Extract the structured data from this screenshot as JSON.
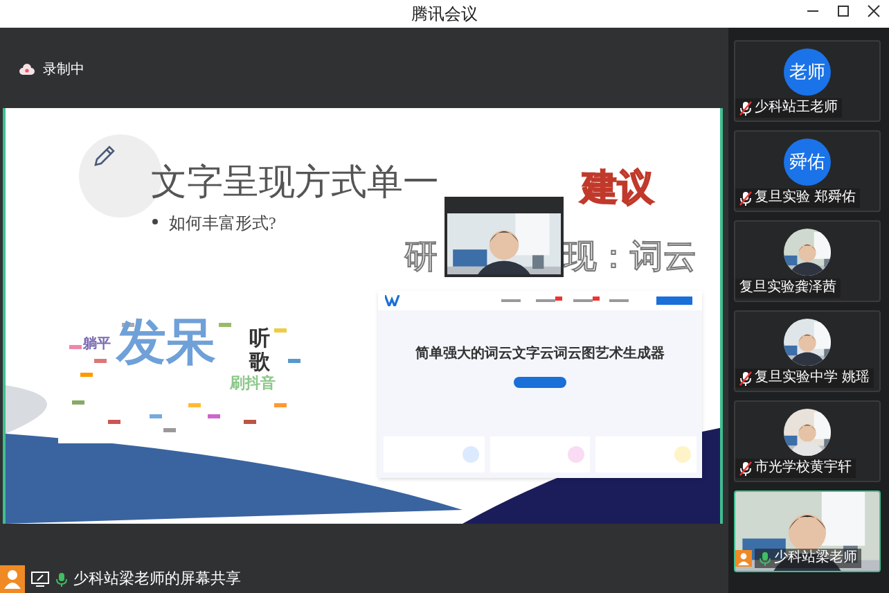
{
  "window": {
    "title": "腾讯会议"
  },
  "recording": {
    "label": "录制中"
  },
  "shared_slide": {
    "title": "文字呈现方式单一",
    "bullet": "如何丰富形式?",
    "suggestion": "建议",
    "subtitle_left": "研",
    "subtitle_right": "现：词云",
    "word_cloud": [
      {
        "text": "躺平",
        "kind": "small",
        "color": "#7a6bb0"
      },
      {
        "text": "发呆",
        "kind": "big",
        "color": "#6fa0d8"
      },
      {
        "text": "听歌",
        "kind": "vertical",
        "color": "#333333"
      },
      {
        "text": "刷抖音",
        "kind": "medium",
        "color": "#8cc88a"
      }
    ],
    "website": {
      "headline": "简单强大的词云文字云词云图艺术生成器"
    }
  },
  "participants": [
    {
      "name": "少科站王老师",
      "kind": "initials",
      "avatar_text": "老师",
      "mic_shown": true,
      "muted": true,
      "speaking": false
    },
    {
      "name": "复旦实验 郑舜佑",
      "kind": "initials",
      "avatar_text": "舜佑",
      "mic_shown": true,
      "muted": true,
      "speaking": false
    },
    {
      "name": "复旦实验龚泽茜",
      "mic_shown": false,
      "speaking": false
    },
    {
      "name": "复旦实验中学 姚瑶",
      "mic_shown": true,
      "muted": true,
      "speaking": false
    },
    {
      "name": "市光学校黄宇轩",
      "mic_shown": true,
      "muted": true,
      "speaking": false
    },
    {
      "name": "少科站梁老师",
      "kind": "video",
      "mic_shown": true,
      "muted": false,
      "speaking": true
    }
  ],
  "share_label": {
    "text": "少科站梁老师的屏幕共享"
  }
}
